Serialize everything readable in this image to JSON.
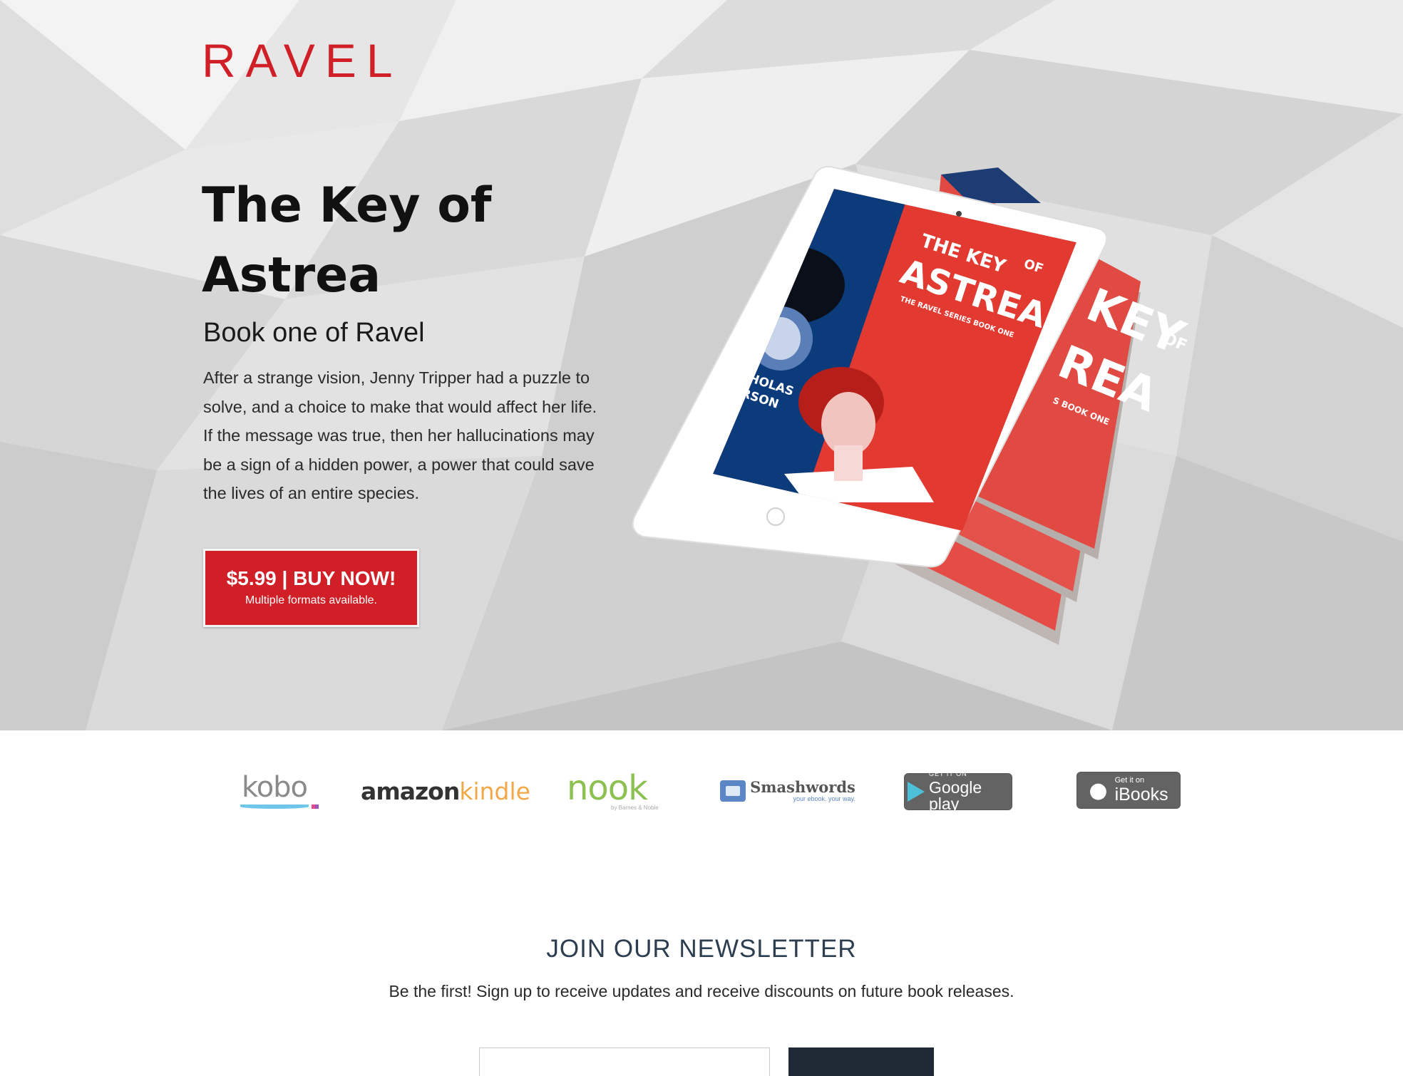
{
  "brand": {
    "logo_text": "RAVEL",
    "accent_color": "#d01f27"
  },
  "hero": {
    "title": "The Key of Astrea",
    "subtitle": "Book one of Ravel",
    "description": "After a strange vision, Jenny Tripper had a puzzle to solve, and a choice to make that would affect her life. If the message was true, then her hallucinations may be a sign of a hidden power, a power that could save the lives of an entire species.",
    "buy_button": {
      "label": "$5.99 | BUY NOW!",
      "sublabel": "Multiple formats available."
    },
    "cover": {
      "title_line1": "THE KEY",
      "title_of": "OF",
      "title_line2": "ASTREA",
      "series": "THE RAVEL SERIES BOOK ONE",
      "author_first": "NICHOLAS",
      "author_last": "MARSON",
      "back_title_line1": "KEY",
      "back_title_of": "OF",
      "back_title_line2": "REA",
      "back_series": "S BOOK ONE"
    }
  },
  "stores": {
    "kobo": "kobo",
    "amazon_a": "amazon",
    "amazon_k": "kindle",
    "nook": "nook",
    "nook_sub": "by Barnes & Noble",
    "smashwords": "Smashwords",
    "smashwords_sub": "your ebook. your way.",
    "google_small": "GET IT ON",
    "google_main": "Google play",
    "ibooks_small": "Get it on",
    "ibooks_main": "iBooks"
  },
  "newsletter": {
    "title": "JOIN OUR NEWSLETTER",
    "text": "Be the first! Sign up to receive updates and receive discounts on future book releases."
  }
}
